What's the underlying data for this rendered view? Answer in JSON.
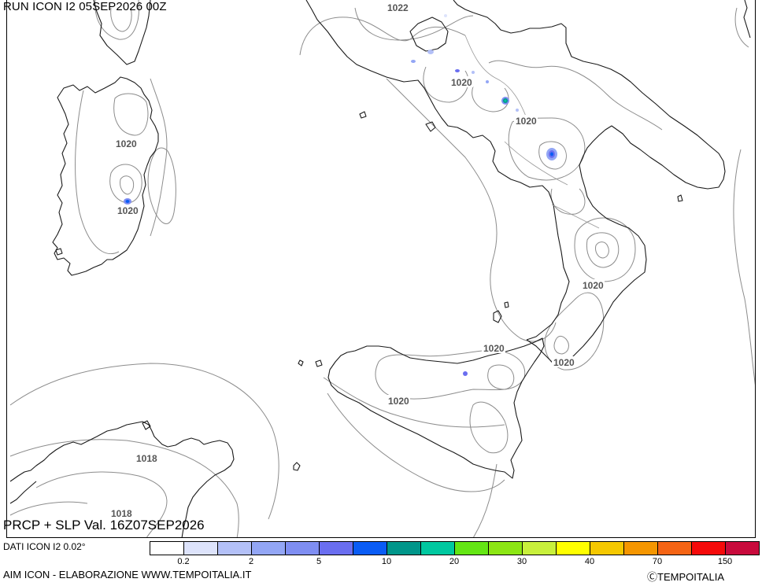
{
  "header": {
    "run_title": "RUN ICON I2 05SEP2026 00Z"
  },
  "footer": {
    "product_title": "PRCP + SLP Val. 16Z07SEP2026",
    "data_source": "DATI ICON I2 0.02°",
    "credit": "AIM ICON - ELABORAZIONE WWW.TEMPOITALIA.IT",
    "copyright": "ⒸTEMPOITALIA"
  },
  "isobar_labels": [
    "1022",
    "1020",
    "1020",
    "1020",
    "1020",
    "1020",
    "1020",
    "1020",
    "1020",
    "1018",
    "1018"
  ],
  "legend": {
    "colors": [
      "#ffffff",
      "#dde3fb",
      "#b3c0f7",
      "#93a6f5",
      "#7f8ef2",
      "#6a6ef0",
      "#0a5cf5",
      "#00968a",
      "#00c8a0",
      "#64e614",
      "#8ce614",
      "#c8f03c",
      "#ffff00",
      "#f5c800",
      "#f59600",
      "#f56414",
      "#f50a0a",
      "#c80a3c"
    ],
    "tick_labels": [
      "0.2",
      "2",
      "5",
      "10",
      "20",
      "30",
      "40",
      "70",
      "150"
    ]
  }
}
